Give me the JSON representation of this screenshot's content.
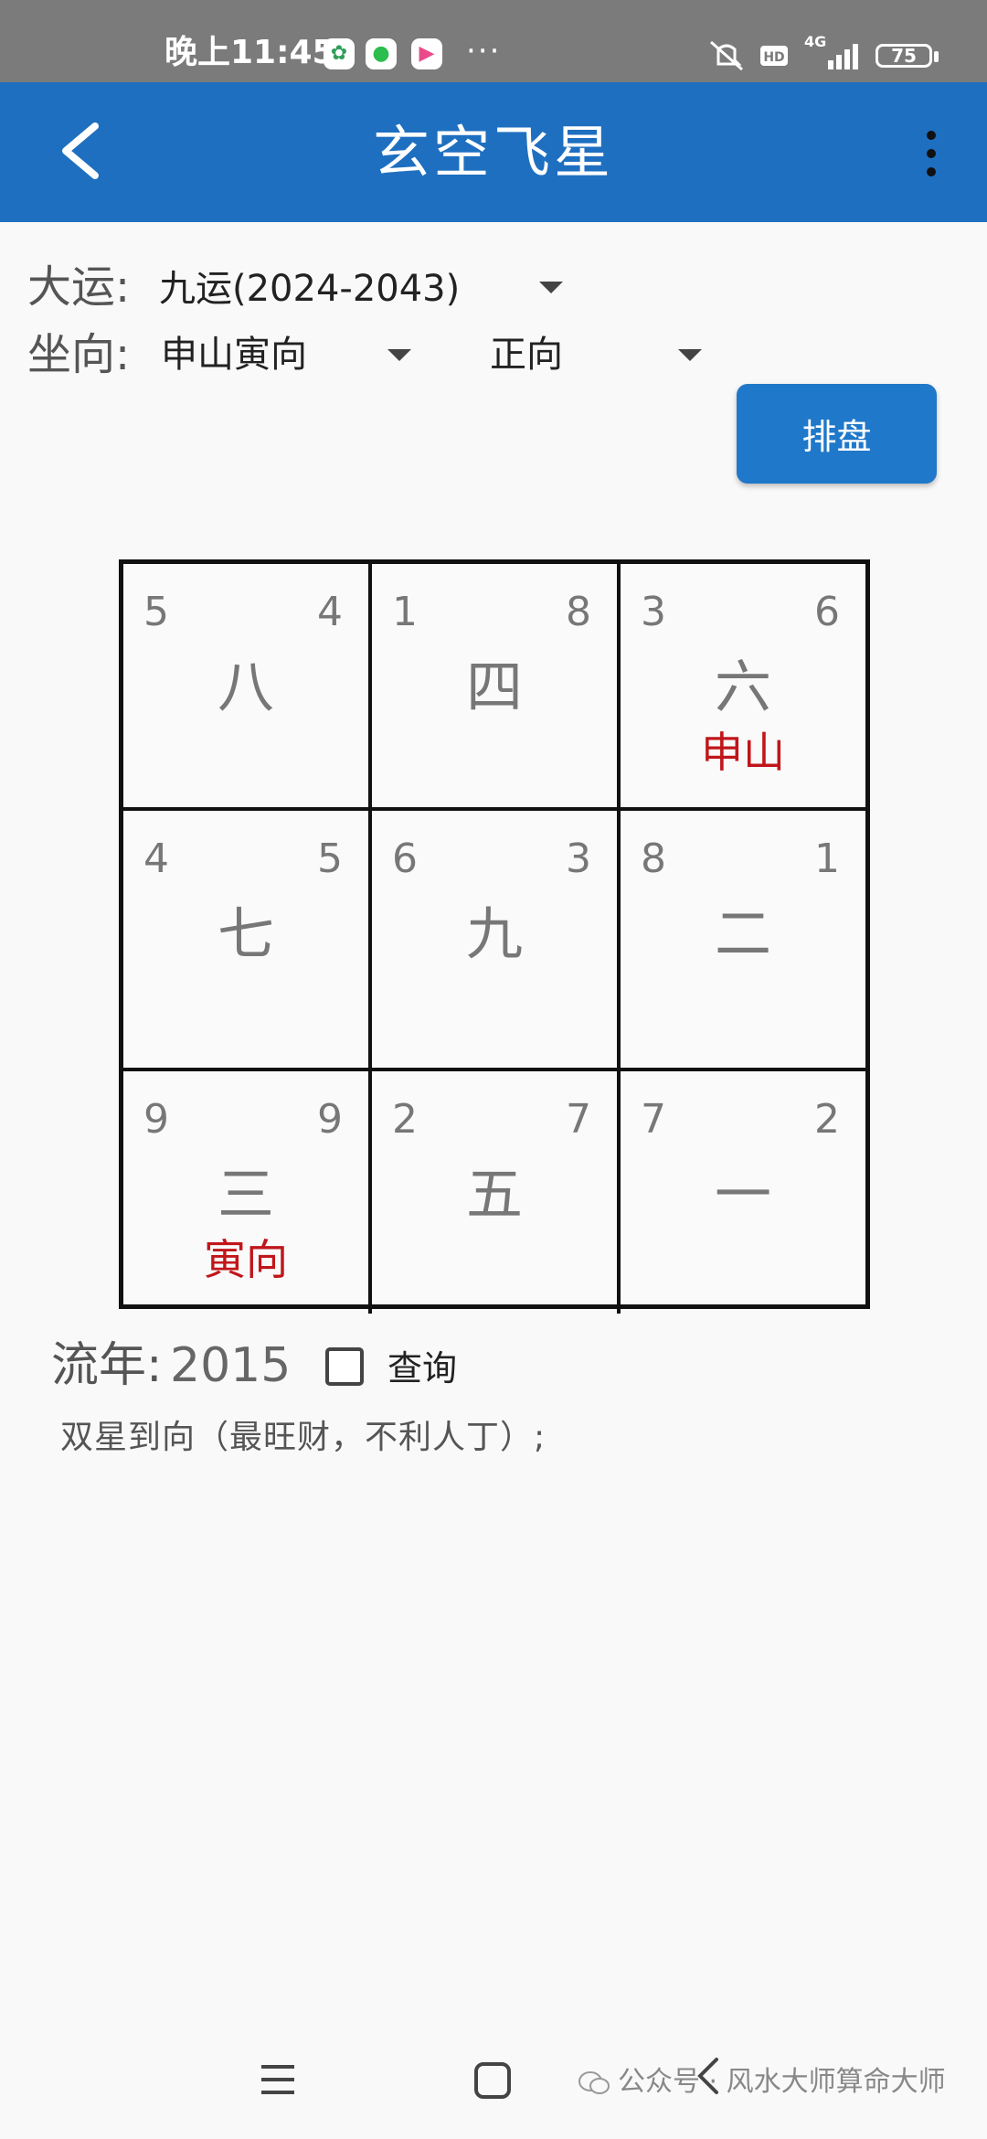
{
  "status_bar": {
    "time": "晚上11:45",
    "dots": "···",
    "network": "4G",
    "battery": "75"
  },
  "app_bar": {
    "title": "玄空飞星"
  },
  "form": {
    "period_label": "大运:",
    "period_value": "九运(2024-2043)",
    "facing_label": "坐向:",
    "facing_value": "申山寅向",
    "direction_value": "正向",
    "plot_button": "排盘"
  },
  "grid": {
    "cells": [
      {
        "left": "5",
        "right": "4",
        "star": "八",
        "tag": ""
      },
      {
        "left": "1",
        "right": "8",
        "star": "四",
        "tag": ""
      },
      {
        "left": "3",
        "right": "6",
        "star": "六",
        "tag": "申山"
      },
      {
        "left": "4",
        "right": "5",
        "star": "七",
        "tag": ""
      },
      {
        "left": "6",
        "right": "3",
        "star": "九",
        "tag": ""
      },
      {
        "left": "8",
        "right": "1",
        "star": "二",
        "tag": ""
      },
      {
        "left": "9",
        "right": "9",
        "star": "三",
        "tag": "寅向"
      },
      {
        "left": "2",
        "right": "7",
        "star": "五",
        "tag": ""
      },
      {
        "left": "7",
        "right": "2",
        "star": "一",
        "tag": ""
      }
    ],
    "tag_color": "#c0161b"
  },
  "year": {
    "label": "流年:",
    "value": "2015",
    "query_label": "查询",
    "query_checked": false
  },
  "result": {
    "text": "双星到向（最旺财，不利人丁）;"
  },
  "watermark": {
    "text": "公众号 · 风水大师算命大师"
  },
  "colors": {
    "app_bar": "#1e6fc0",
    "button": "#1f78c9",
    "status_bar": "#7b7b7b"
  }
}
